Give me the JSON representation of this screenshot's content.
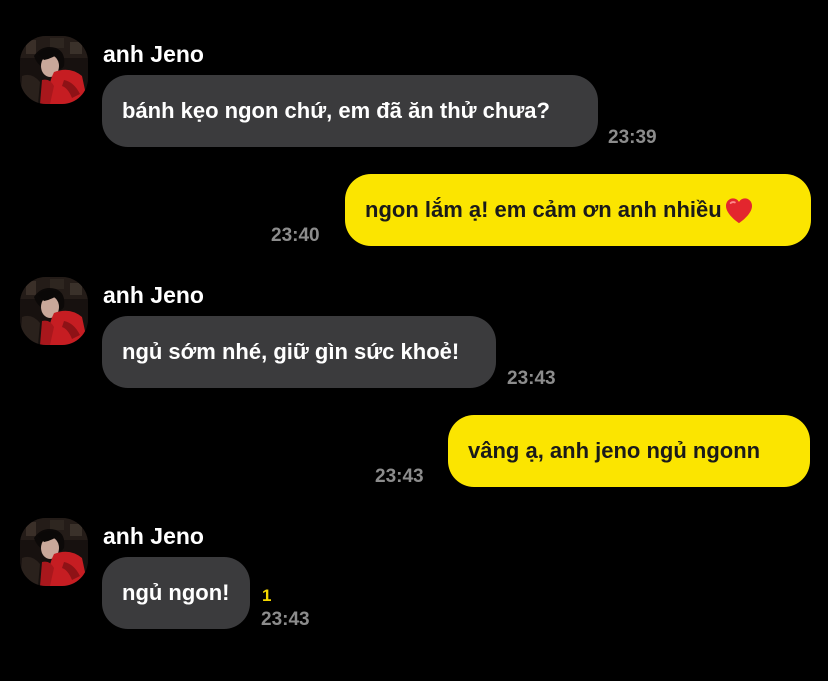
{
  "chat": {
    "contact_name": "anh Jeno",
    "avatar_icon": "profile-photo",
    "colors": {
      "background": "#000000",
      "incoming_bubble": "#3b3b3d",
      "outgoing_bubble": "#fbe500",
      "timestamp": "#8c8c8c",
      "unread_count": "#f5d800"
    },
    "messages": [
      {
        "direction": "incoming",
        "sender": "anh Jeno",
        "text": "bánh kẹo ngon chứ, em đã ăn thử chưa?",
        "time": "23:39"
      },
      {
        "direction": "outgoing",
        "text": "ngon lắm ạ! em cảm ơn anh nhiều",
        "emoji": "red-heart-icon",
        "time": "23:40"
      },
      {
        "direction": "incoming",
        "sender": "anh Jeno",
        "text": "ngủ sớm nhé, giữ gìn sức khoẻ!",
        "time": "23:43"
      },
      {
        "direction": "outgoing",
        "text": "vâng ạ, anh jeno ngủ ngonn",
        "time": "23:43"
      },
      {
        "direction": "incoming",
        "sender": "anh Jeno",
        "text": "ngủ ngon!",
        "time": "23:43",
        "unread_count": "1"
      }
    ]
  }
}
